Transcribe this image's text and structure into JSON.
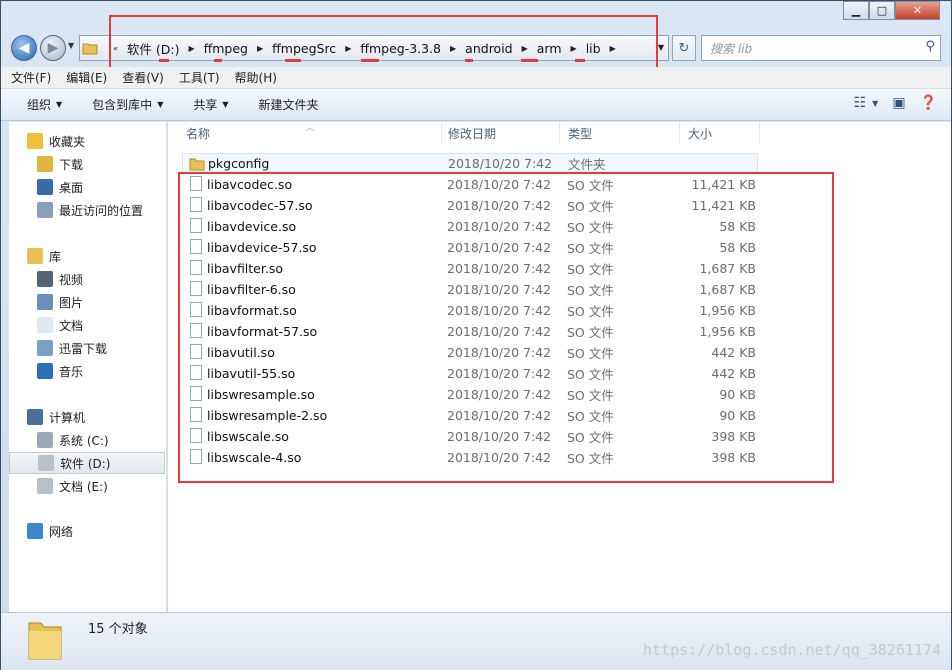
{
  "address": {
    "crumbs": [
      "软件 (D:)",
      "ffmpeg",
      "ffmpegSrc",
      "ffmpeg-3.3.8",
      "android",
      "arm",
      "lib"
    ],
    "search_placeholder": "搜索 lib"
  },
  "menu": [
    "文件(F)",
    "编辑(E)",
    "查看(V)",
    "工具(T)",
    "帮助(H)"
  ],
  "toolbar": {
    "organize": "组织",
    "include_library": "包含到库中",
    "share": "共享",
    "new_folder": "新建文件夹"
  },
  "sidebar": {
    "favorites": "收藏夹",
    "fav_items": [
      "下载",
      "桌面",
      "最近访问的位置"
    ],
    "library": "库",
    "lib_items": [
      "视频",
      "图片",
      "文档",
      "迅雷下载",
      "音乐"
    ],
    "computer": "计算机",
    "drives": [
      "系统 (C:)",
      "软件 (D:)",
      "文档 (E:)"
    ],
    "network": "网络"
  },
  "columns": {
    "name": "名称",
    "date": "修改日期",
    "type": "类型",
    "size": "大小"
  },
  "files": [
    {
      "name": "pkgconfig",
      "date": "2018/10/20 7:42",
      "type": "文件夹",
      "size": "",
      "folder": true
    },
    {
      "name": "libavcodec.so",
      "date": "2018/10/20 7:42",
      "type": "SO 文件",
      "size": "11,421 KB"
    },
    {
      "name": "libavcodec-57.so",
      "date": "2018/10/20 7:42",
      "type": "SO 文件",
      "size": "11,421 KB"
    },
    {
      "name": "libavdevice.so",
      "date": "2018/10/20 7:42",
      "type": "SO 文件",
      "size": "58 KB"
    },
    {
      "name": "libavdevice-57.so",
      "date": "2018/10/20 7:42",
      "type": "SO 文件",
      "size": "58 KB"
    },
    {
      "name": "libavfilter.so",
      "date": "2018/10/20 7:42",
      "type": "SO 文件",
      "size": "1,687 KB"
    },
    {
      "name": "libavfilter-6.so",
      "date": "2018/10/20 7:42",
      "type": "SO 文件",
      "size": "1,687 KB"
    },
    {
      "name": "libavformat.so",
      "date": "2018/10/20 7:42",
      "type": "SO 文件",
      "size": "1,956 KB"
    },
    {
      "name": "libavformat-57.so",
      "date": "2018/10/20 7:42",
      "type": "SO 文件",
      "size": "1,956 KB"
    },
    {
      "name": "libavutil.so",
      "date": "2018/10/20 7:42",
      "type": "SO 文件",
      "size": "442 KB"
    },
    {
      "name": "libavutil-55.so",
      "date": "2018/10/20 7:42",
      "type": "SO 文件",
      "size": "442 KB"
    },
    {
      "name": "libswresample.so",
      "date": "2018/10/20 7:42",
      "type": "SO 文件",
      "size": "90 KB"
    },
    {
      "name": "libswresample-2.so",
      "date": "2018/10/20 7:42",
      "type": "SO 文件",
      "size": "90 KB"
    },
    {
      "name": "libswscale.so",
      "date": "2018/10/20 7:42",
      "type": "SO 文件",
      "size": "398 KB"
    },
    {
      "name": "libswscale-4.so",
      "date": "2018/10/20 7:42",
      "type": "SO 文件",
      "size": "398 KB"
    }
  ],
  "status": {
    "count": "15 个对象"
  },
  "watermark": "https://blog.csdn.net/qq_38261174",
  "colors": {
    "annotation": "#e53b3b",
    "accent": "#2a63b0"
  }
}
